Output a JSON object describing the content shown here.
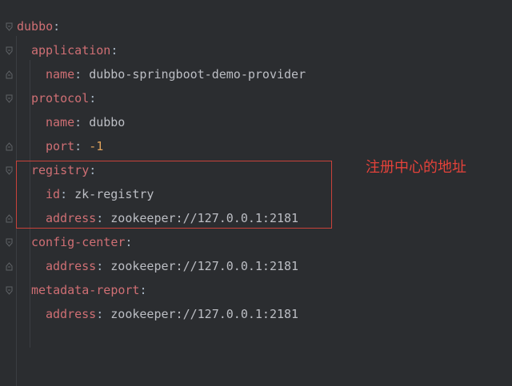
{
  "yaml": {
    "root_key": "dubbo",
    "application_key": "application",
    "application_name_key": "name",
    "application_name_value": "dubbo-springboot-demo-provider",
    "protocol_key": "protocol",
    "protocol_name_key": "name",
    "protocol_name_value": "dubbo",
    "protocol_port_key": "port",
    "protocol_port_value": "-1",
    "registry_key": "registry",
    "registry_id_key": "id",
    "registry_id_value": "zk-registry",
    "registry_address_key": "address",
    "registry_address_value": "zookeeper://127.0.0.1:2181",
    "config_center_key": "config-center",
    "config_center_address_key": "address",
    "config_center_address_value": "zookeeper://127.0.0.1:2181",
    "metadata_report_key": "metadata-report",
    "metadata_report_address_key": "address",
    "metadata_report_address_value": "zookeeper://127.0.0.1:2181",
    "colon": ":"
  },
  "annotation": {
    "text": "注册中心的地址"
  },
  "colors": {
    "background": "#2b2d30",
    "key": "#cf6f74",
    "value": "#bcbec4",
    "number": "#e0a35c",
    "annotation": "#e5423a"
  }
}
